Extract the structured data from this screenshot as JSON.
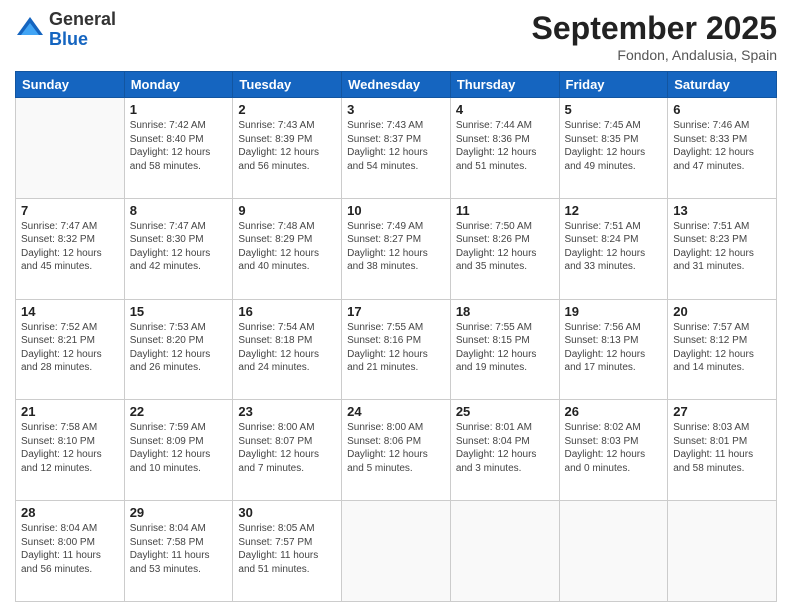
{
  "logo": {
    "general": "General",
    "blue": "Blue"
  },
  "title": "September 2025",
  "location": "Fondon, Andalusia, Spain",
  "weekdays": [
    "Sunday",
    "Monday",
    "Tuesday",
    "Wednesday",
    "Thursday",
    "Friday",
    "Saturday"
  ],
  "weeks": [
    [
      {
        "day": "",
        "info": ""
      },
      {
        "day": "1",
        "info": "Sunrise: 7:42 AM\nSunset: 8:40 PM\nDaylight: 12 hours\nand 58 minutes."
      },
      {
        "day": "2",
        "info": "Sunrise: 7:43 AM\nSunset: 8:39 PM\nDaylight: 12 hours\nand 56 minutes."
      },
      {
        "day": "3",
        "info": "Sunrise: 7:43 AM\nSunset: 8:37 PM\nDaylight: 12 hours\nand 54 minutes."
      },
      {
        "day": "4",
        "info": "Sunrise: 7:44 AM\nSunset: 8:36 PM\nDaylight: 12 hours\nand 51 minutes."
      },
      {
        "day": "5",
        "info": "Sunrise: 7:45 AM\nSunset: 8:35 PM\nDaylight: 12 hours\nand 49 minutes."
      },
      {
        "day": "6",
        "info": "Sunrise: 7:46 AM\nSunset: 8:33 PM\nDaylight: 12 hours\nand 47 minutes."
      }
    ],
    [
      {
        "day": "7",
        "info": "Sunrise: 7:47 AM\nSunset: 8:32 PM\nDaylight: 12 hours\nand 45 minutes."
      },
      {
        "day": "8",
        "info": "Sunrise: 7:47 AM\nSunset: 8:30 PM\nDaylight: 12 hours\nand 42 minutes."
      },
      {
        "day": "9",
        "info": "Sunrise: 7:48 AM\nSunset: 8:29 PM\nDaylight: 12 hours\nand 40 minutes."
      },
      {
        "day": "10",
        "info": "Sunrise: 7:49 AM\nSunset: 8:27 PM\nDaylight: 12 hours\nand 38 minutes."
      },
      {
        "day": "11",
        "info": "Sunrise: 7:50 AM\nSunset: 8:26 PM\nDaylight: 12 hours\nand 35 minutes."
      },
      {
        "day": "12",
        "info": "Sunrise: 7:51 AM\nSunset: 8:24 PM\nDaylight: 12 hours\nand 33 minutes."
      },
      {
        "day": "13",
        "info": "Sunrise: 7:51 AM\nSunset: 8:23 PM\nDaylight: 12 hours\nand 31 minutes."
      }
    ],
    [
      {
        "day": "14",
        "info": "Sunrise: 7:52 AM\nSunset: 8:21 PM\nDaylight: 12 hours\nand 28 minutes."
      },
      {
        "day": "15",
        "info": "Sunrise: 7:53 AM\nSunset: 8:20 PM\nDaylight: 12 hours\nand 26 minutes."
      },
      {
        "day": "16",
        "info": "Sunrise: 7:54 AM\nSunset: 8:18 PM\nDaylight: 12 hours\nand 24 minutes."
      },
      {
        "day": "17",
        "info": "Sunrise: 7:55 AM\nSunset: 8:16 PM\nDaylight: 12 hours\nand 21 minutes."
      },
      {
        "day": "18",
        "info": "Sunrise: 7:55 AM\nSunset: 8:15 PM\nDaylight: 12 hours\nand 19 minutes."
      },
      {
        "day": "19",
        "info": "Sunrise: 7:56 AM\nSunset: 8:13 PM\nDaylight: 12 hours\nand 17 minutes."
      },
      {
        "day": "20",
        "info": "Sunrise: 7:57 AM\nSunset: 8:12 PM\nDaylight: 12 hours\nand 14 minutes."
      }
    ],
    [
      {
        "day": "21",
        "info": "Sunrise: 7:58 AM\nSunset: 8:10 PM\nDaylight: 12 hours\nand 12 minutes."
      },
      {
        "day": "22",
        "info": "Sunrise: 7:59 AM\nSunset: 8:09 PM\nDaylight: 12 hours\nand 10 minutes."
      },
      {
        "day": "23",
        "info": "Sunrise: 8:00 AM\nSunset: 8:07 PM\nDaylight: 12 hours\nand 7 minutes."
      },
      {
        "day": "24",
        "info": "Sunrise: 8:00 AM\nSunset: 8:06 PM\nDaylight: 12 hours\nand 5 minutes."
      },
      {
        "day": "25",
        "info": "Sunrise: 8:01 AM\nSunset: 8:04 PM\nDaylight: 12 hours\nand 3 minutes."
      },
      {
        "day": "26",
        "info": "Sunrise: 8:02 AM\nSunset: 8:03 PM\nDaylight: 12 hours\nand 0 minutes."
      },
      {
        "day": "27",
        "info": "Sunrise: 8:03 AM\nSunset: 8:01 PM\nDaylight: 11 hours\nand 58 minutes."
      }
    ],
    [
      {
        "day": "28",
        "info": "Sunrise: 8:04 AM\nSunset: 8:00 PM\nDaylight: 11 hours\nand 56 minutes."
      },
      {
        "day": "29",
        "info": "Sunrise: 8:04 AM\nSunset: 7:58 PM\nDaylight: 11 hours\nand 53 minutes."
      },
      {
        "day": "30",
        "info": "Sunrise: 8:05 AM\nSunset: 7:57 PM\nDaylight: 11 hours\nand 51 minutes."
      },
      {
        "day": "",
        "info": ""
      },
      {
        "day": "",
        "info": ""
      },
      {
        "day": "",
        "info": ""
      },
      {
        "day": "",
        "info": ""
      }
    ]
  ]
}
